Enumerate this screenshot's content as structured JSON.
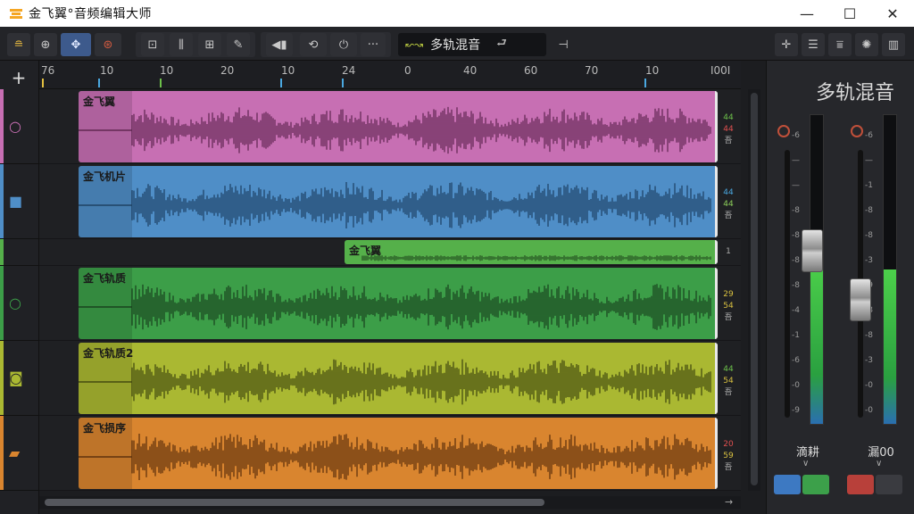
{
  "window": {
    "title": "金飞翼°音频编辑大师",
    "minimize": "—",
    "maximize": "☐",
    "close": "✕"
  },
  "toolbar": {
    "mode_label": "多轨混音",
    "mode_icon_text": "↜↝",
    "more": "···"
  },
  "sidebar": {
    "add_label": "+"
  },
  "ruler": {
    "ticks": [
      "76",
      "10",
      "10",
      "20",
      "10",
      "24",
      "0",
      "40",
      "60",
      "70",
      "10",
      "I00I"
    ]
  },
  "tracks": [
    {
      "name": "金飞翼",
      "color": "#c76fb3",
      "dark": "#6e2f5e",
      "meta": [
        "44",
        "44",
        "吾"
      ],
      "meta_colors": [
        "#6cc04a",
        "#e05050",
        "#aaa"
      ]
    },
    {
      "name": "金飞机片",
      "color": "#4f8ec7",
      "dark": "#234a70",
      "meta": [
        "44",
        "44",
        "吾"
      ],
      "meta_colors": [
        "#4aa8e0",
        "#8ccf5a",
        "#aaa"
      ]
    },
    {
      "name": "金飞翼",
      "color": "#55b04a",
      "dark": "#2a5a25",
      "meta": [
        "1"
      ],
      "meta_colors": [
        "#aaa"
      ]
    },
    {
      "name": "金飞轨质",
      "color": "#3c9e48",
      "dark": "#1d4d23",
      "meta": [
        "29",
        "54",
        "吾"
      ],
      "meta_colors": [
        "#d8c040",
        "#d8c040",
        "#aaa"
      ]
    },
    {
      "name": "金飞轨质2",
      "color": "#aab832",
      "dark": "#4d5513",
      "meta": [
        "44",
        "54",
        "吾"
      ],
      "meta_colors": [
        "#6cc04a",
        "#d8c040",
        "#aaa"
      ]
    },
    {
      "name": "金飞损序",
      "color": "#d9852f",
      "dark": "#6b3a10",
      "meta": [
        "20",
        "59",
        "吾"
      ],
      "meta_colors": [
        "#e05050",
        "#d8c040",
        "#aaa"
      ]
    }
  ],
  "mixer": {
    "title": "多轨混音",
    "channels": [
      {
        "name": "滴耕",
        "level": 0.53,
        "fader": 0.62,
        "colors": [
          "#3d79c2",
          "#3ca04a"
        ]
      },
      {
        "name": "漏00",
        "level": 0.5,
        "fader": 0.46,
        "colors": [
          "#b8403a",
          "#3a3b40"
        ]
      }
    ],
    "scale_a": [
      "-6",
      "—",
      "—",
      "-8",
      "-8",
      "-8",
      "-8",
      "-4",
      "-1",
      "-6",
      "-0",
      "-9"
    ],
    "scale_b": [
      "-6",
      "—",
      "-1",
      "-8",
      "-8",
      "-3",
      "-9",
      "-8",
      "-8",
      "-3",
      "-0",
      "-0"
    ]
  }
}
